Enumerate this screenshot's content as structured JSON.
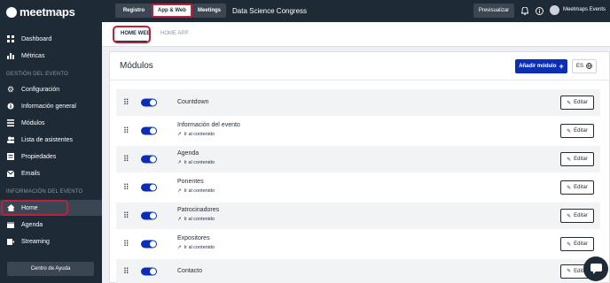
{
  "brand": {
    "name": "meetmaps"
  },
  "sidebar": {
    "top_items": [
      {
        "label": "Dashboard"
      },
      {
        "label": "Métricas"
      }
    ],
    "section1": "GESTIÓN DEL EVENTO",
    "items1": [
      {
        "label": "Configuración"
      },
      {
        "label": "Información general"
      },
      {
        "label": "Módulos"
      },
      {
        "label": "Lista de asistentes"
      },
      {
        "label": "Propiedades"
      },
      {
        "label": "Emails"
      }
    ],
    "section2": "INFORMACIÓN DEL EVENTO",
    "items2": [
      {
        "label": "Home"
      },
      {
        "label": "Agenda"
      },
      {
        "label": "Streaming"
      }
    ],
    "help_label": "Centro de Ayuda"
  },
  "topbar": {
    "tabs": [
      {
        "label": "Registro"
      },
      {
        "label": "App & Web"
      },
      {
        "label": "Meetings"
      }
    ],
    "event_name": "Data Science Congress",
    "preview_label": "Previsualizar",
    "account_name": "Meetmaps Events"
  },
  "subtabs": [
    {
      "label": "HOME WEB"
    },
    {
      "label": "HOME APP"
    }
  ],
  "card": {
    "title": "Módulos",
    "add_label": "Añadir módulo",
    "lang_label": "ES"
  },
  "modules": [
    {
      "name": "Countdown",
      "link": ""
    },
    {
      "name": "Información del evento",
      "link": "Ir al contenido"
    },
    {
      "name": "Agenda",
      "link": "Ir al contenido"
    },
    {
      "name": "Ponentes",
      "link": "Ir al contenido"
    },
    {
      "name": "Patrocinadores",
      "link": "Ir al contenido"
    },
    {
      "name": "Expositores",
      "link": "Ir al contenido"
    },
    {
      "name": "Contacto",
      "link": ""
    }
  ],
  "edit_label": "Editar",
  "colors": {
    "sidebar": "#1f2a37",
    "accent": "#0a2fb5",
    "highlight": "#c0203a"
  }
}
